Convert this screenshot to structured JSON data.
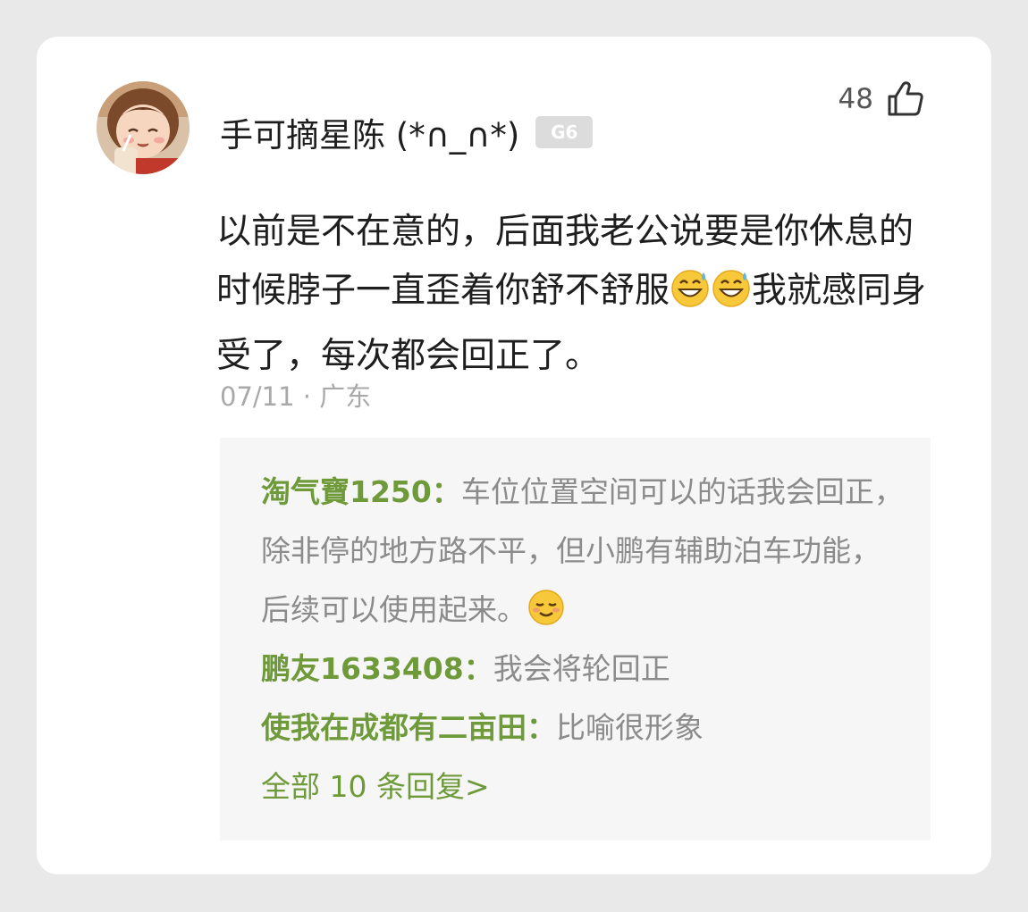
{
  "comment": {
    "author": "手可摘星陈 (*∩_∩*)",
    "level_badge": "G6",
    "likes": "48",
    "text_part1": "以前是不在意的，后面我老公说要是你休息的时候脖子一直歪着你舒不舒服",
    "text_part2": "我就感同身受了，每次都会回正了。",
    "emoji_1": "grinning-face-with-sweat",
    "emoji_2": "grinning-face-with-sweat",
    "date_location": "07/11 · 广东"
  },
  "replies": [
    {
      "author": "淘气寶1250：",
      "text": "车位位置空间可以的话我会回正，除非停的地方路不平，但小鹏有辅助泊车功能，后续可以使用起来。",
      "emoji": "smiling-face"
    },
    {
      "author": "鹏友1633408：",
      "text": "我会将轮回正"
    },
    {
      "author": "使我在成都有二亩田：",
      "text": "比喻很形象"
    }
  ],
  "all_replies_link": "全部 10 条回复>",
  "colors": {
    "accent_green": "#6f9a3a",
    "card_bg": "#ffffff",
    "page_bg": "#e9e9e9",
    "reply_bg": "#f6f6f6"
  }
}
